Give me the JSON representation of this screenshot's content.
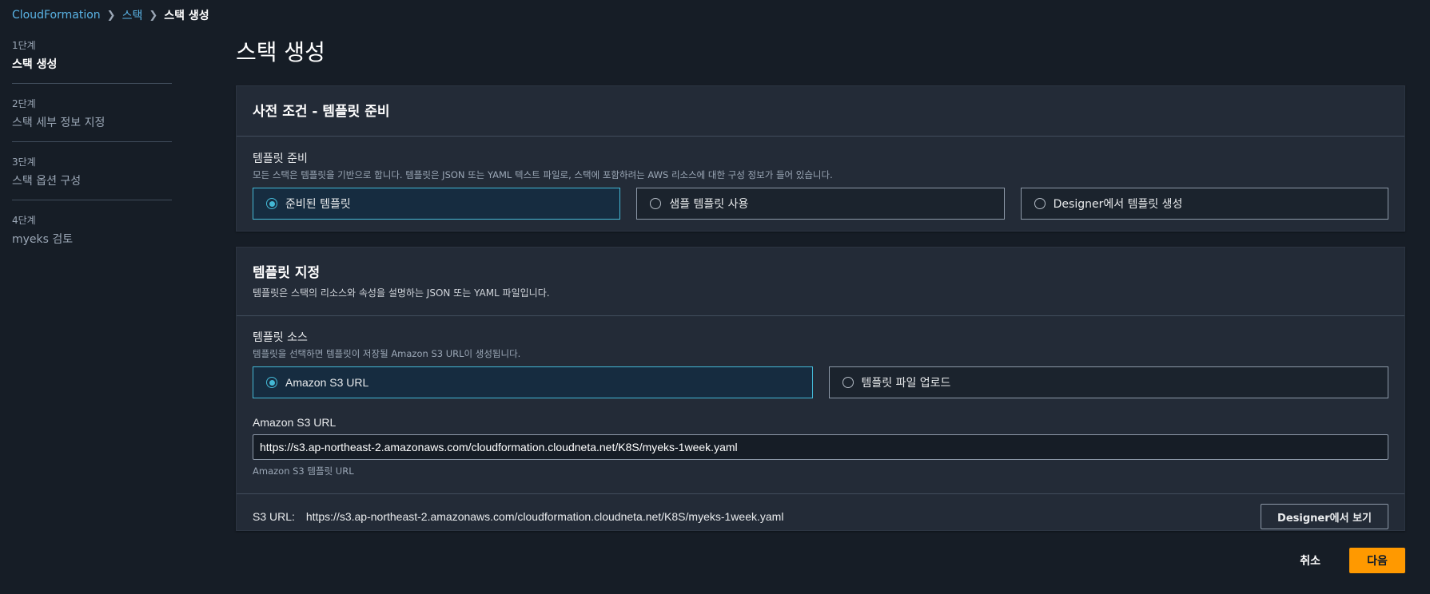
{
  "breadcrumb": {
    "items": [
      "CloudFormation",
      "스택",
      "스택 생성"
    ]
  },
  "steps": [
    {
      "num": "1단계",
      "label": "스택 생성",
      "active": true
    },
    {
      "num": "2단계",
      "label": "스택 세부 정보 지정",
      "active": false
    },
    {
      "num": "3단계",
      "label": "스택 옵션 구성",
      "active": false
    },
    {
      "num": "4단계",
      "label": "myeks 검토",
      "active": false
    }
  ],
  "page_title": "스택 생성",
  "prereq": {
    "title": "사전 조건 - 템플릿 준비",
    "field_label": "템플릿 준비",
    "field_desc": "모든 스택은 템플릿을 기반으로 합니다. 템플릿은 JSON 또는 YAML 텍스트 파일로, 스택에 포함하려는 AWS 리소스에 대한 구성 정보가 들어 있습니다.",
    "options": [
      {
        "label": "준비된 템플릿",
        "selected": true
      },
      {
        "label": "샘플 템플릿 사용",
        "selected": false
      },
      {
        "label": "Designer에서 템플릿 생성",
        "selected": false
      }
    ]
  },
  "template_spec": {
    "title": "템플릿 지정",
    "desc": "템플릿은 스택의 리소스와 속성을 설명하는 JSON 또는 YAML 파일입니다.",
    "source_label": "템플릿 소스",
    "source_desc": "템플릿을 선택하면 템플릿이 저장될 Amazon S3 URL이 생성됩니다.",
    "options": [
      {
        "label": "Amazon S3 URL",
        "selected": true
      },
      {
        "label": "템플릿 파일 업로드",
        "selected": false
      }
    ],
    "url_label": "Amazon S3 URL",
    "url_value": "https://s3.ap-northeast-2.amazonaws.com/cloudformation.cloudneta.net/K8S/myeks-1week.yaml",
    "url_constraint": "Amazon S3 템플릿 URL",
    "footer_label": "S3 URL:",
    "footer_url": "https://s3.ap-northeast-2.amazonaws.com/cloudformation.cloudneta.net/K8S/myeks-1week.yaml",
    "designer_button": "Designer에서 보기"
  },
  "actions": {
    "cancel": "취소",
    "next": "다음"
  },
  "colors": {
    "accent": "#44b9d6",
    "primary_button": "#ff9900",
    "background": "#161d26",
    "panel": "#232b37"
  }
}
